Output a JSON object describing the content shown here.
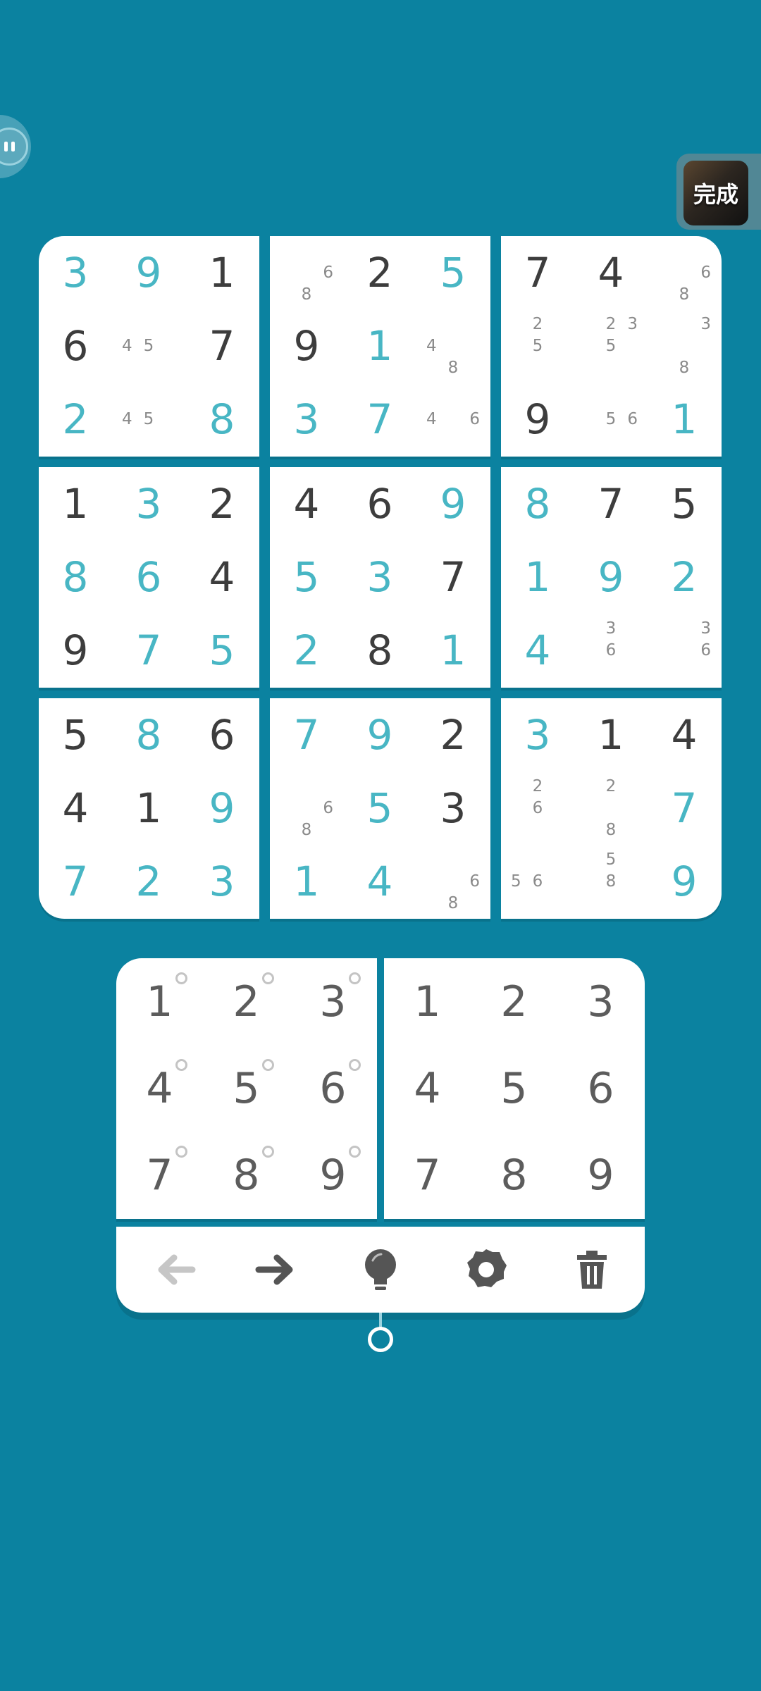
{
  "colors": {
    "background": "#0b82a0",
    "given_digit": "#3d3d3d",
    "entered_digit": "#48b6c4",
    "note_digit": "#8a8a8a",
    "keypad_digit": "#5c5c5c"
  },
  "overlay": {
    "left_float_icon": "pause-icon",
    "done_badge_label": "完成"
  },
  "grid": [
    [
      {
        "v": "3",
        "t": "entered"
      },
      {
        "v": "9",
        "t": "entered"
      },
      {
        "v": "1",
        "t": "given"
      },
      {
        "v": "",
        "t": "note",
        "n": [
          "",
          "",
          "",
          "",
          "",
          "6",
          "",
          "8",
          ""
        ]
      },
      {
        "v": "2",
        "t": "given"
      },
      {
        "v": "5",
        "t": "entered"
      },
      {
        "v": "7",
        "t": "given"
      },
      {
        "v": "4",
        "t": "given"
      },
      {
        "v": "",
        "t": "note",
        "n": [
          "",
          "",
          "",
          "",
          "",
          "6",
          "",
          "8",
          ""
        ]
      }
    ],
    [
      {
        "v": "6",
        "t": "given"
      },
      {
        "v": "",
        "t": "note",
        "n": [
          "",
          "",
          "",
          "4",
          "5",
          "",
          "",
          "",
          ""
        ]
      },
      {
        "v": "7",
        "t": "given"
      },
      {
        "v": "9",
        "t": "given"
      },
      {
        "v": "1",
        "t": "entered"
      },
      {
        "v": "",
        "t": "note",
        "n": [
          "",
          "",
          "",
          "4",
          "",
          "",
          "",
          "8",
          ""
        ]
      },
      {
        "v": "",
        "t": "note",
        "n": [
          "",
          "2",
          "",
          "",
          "5",
          "",
          "",
          "",
          ""
        ]
      },
      {
        "v": "",
        "t": "note",
        "n": [
          "",
          "2",
          "3",
          "",
          "5",
          "",
          "",
          "",
          ""
        ]
      },
      {
        "v": "",
        "t": "note",
        "n": [
          "",
          "",
          "3",
          "",
          "",
          "",
          "",
          "8",
          ""
        ]
      }
    ],
    [
      {
        "v": "2",
        "t": "entered"
      },
      {
        "v": "",
        "t": "note",
        "n": [
          "",
          "",
          "",
          "4",
          "5",
          "",
          "",
          "",
          ""
        ]
      },
      {
        "v": "8",
        "t": "entered"
      },
      {
        "v": "3",
        "t": "entered"
      },
      {
        "v": "7",
        "t": "entered"
      },
      {
        "v": "",
        "t": "note",
        "n": [
          "",
          "",
          "",
          "4",
          "",
          "6",
          "",
          "",
          ""
        ]
      },
      {
        "v": "9",
        "t": "given"
      },
      {
        "v": "",
        "t": "note",
        "n": [
          "",
          "",
          "",
          "",
          "5",
          "6",
          "",
          "",
          ""
        ]
      },
      {
        "v": "1",
        "t": "entered"
      }
    ],
    [
      {
        "v": "1",
        "t": "given"
      },
      {
        "v": "3",
        "t": "entered"
      },
      {
        "v": "2",
        "t": "given"
      },
      {
        "v": "4",
        "t": "given"
      },
      {
        "v": "6",
        "t": "given"
      },
      {
        "v": "9",
        "t": "entered"
      },
      {
        "v": "8",
        "t": "entered"
      },
      {
        "v": "7",
        "t": "given"
      },
      {
        "v": "5",
        "t": "given"
      }
    ],
    [
      {
        "v": "8",
        "t": "entered"
      },
      {
        "v": "6",
        "t": "entered"
      },
      {
        "v": "4",
        "t": "given"
      },
      {
        "v": "5",
        "t": "entered"
      },
      {
        "v": "3",
        "t": "entered"
      },
      {
        "v": "7",
        "t": "given"
      },
      {
        "v": "1",
        "t": "entered"
      },
      {
        "v": "9",
        "t": "entered"
      },
      {
        "v": "2",
        "t": "entered"
      }
    ],
    [
      {
        "v": "9",
        "t": "given"
      },
      {
        "v": "7",
        "t": "entered"
      },
      {
        "v": "5",
        "t": "entered"
      },
      {
        "v": "2",
        "t": "entered"
      },
      {
        "v": "8",
        "t": "given"
      },
      {
        "v": "1",
        "t": "entered"
      },
      {
        "v": "4",
        "t": "entered"
      },
      {
        "v": "",
        "t": "note",
        "n": [
          "",
          "3",
          "",
          "",
          "6",
          "",
          "",
          "",
          ""
        ]
      },
      {
        "v": "",
        "t": "note",
        "n": [
          "",
          "",
          "3",
          "",
          "",
          "6",
          "",
          "",
          ""
        ]
      }
    ],
    [
      {
        "v": "5",
        "t": "given"
      },
      {
        "v": "8",
        "t": "entered"
      },
      {
        "v": "6",
        "t": "given"
      },
      {
        "v": "7",
        "t": "entered"
      },
      {
        "v": "9",
        "t": "entered"
      },
      {
        "v": "2",
        "t": "given"
      },
      {
        "v": "3",
        "t": "entered"
      },
      {
        "v": "1",
        "t": "given"
      },
      {
        "v": "4",
        "t": "given"
      }
    ],
    [
      {
        "v": "4",
        "t": "given"
      },
      {
        "v": "1",
        "t": "given"
      },
      {
        "v": "9",
        "t": "entered"
      },
      {
        "v": "",
        "t": "note",
        "n": [
          "",
          "",
          "",
          "",
          "",
          "6",
          "",
          "8",
          ""
        ]
      },
      {
        "v": "5",
        "t": "entered"
      },
      {
        "v": "3",
        "t": "given"
      },
      {
        "v": "",
        "t": "note",
        "n": [
          "",
          "2",
          "",
          "",
          "6",
          "",
          "",
          "",
          ""
        ]
      },
      {
        "v": "",
        "t": "note",
        "n": [
          "",
          "2",
          "",
          "",
          "",
          "",
          "",
          "8",
          ""
        ]
      },
      {
        "v": "7",
        "t": "entered"
      }
    ],
    [
      {
        "v": "7",
        "t": "entered"
      },
      {
        "v": "2",
        "t": "entered"
      },
      {
        "v": "3",
        "t": "entered"
      },
      {
        "v": "1",
        "t": "entered"
      },
      {
        "v": "4",
        "t": "entered"
      },
      {
        "v": "",
        "t": "note",
        "n": [
          "",
          "",
          "",
          "",
          "",
          "6",
          "",
          "8",
          ""
        ]
      },
      {
        "v": "",
        "t": "note",
        "n": [
          "",
          "",
          "",
          "5",
          "6",
          "",
          "",
          "",
          ""
        ]
      },
      {
        "v": "",
        "t": "note",
        "n": [
          "",
          "5",
          "",
          "",
          "8",
          "",
          "",
          "",
          ""
        ]
      },
      {
        "v": "9",
        "t": "entered"
      }
    ]
  ],
  "keypad": {
    "notes_keys": [
      "1",
      "2",
      "3",
      "4",
      "5",
      "6",
      "7",
      "8",
      "9"
    ],
    "value_keys": [
      "1",
      "2",
      "3",
      "4",
      "5",
      "6",
      "7",
      "8",
      "9"
    ]
  },
  "toolbar": [
    {
      "name": "undo-button",
      "icon": "arrow-left-icon",
      "enabled": false
    },
    {
      "name": "redo-button",
      "icon": "arrow-right-icon",
      "enabled": true
    },
    {
      "name": "hint-button",
      "icon": "lightbulb-icon",
      "enabled": true
    },
    {
      "name": "settings-button",
      "icon": "gear-icon",
      "enabled": true
    },
    {
      "name": "clear-button",
      "icon": "trash-icon",
      "enabled": true
    }
  ]
}
